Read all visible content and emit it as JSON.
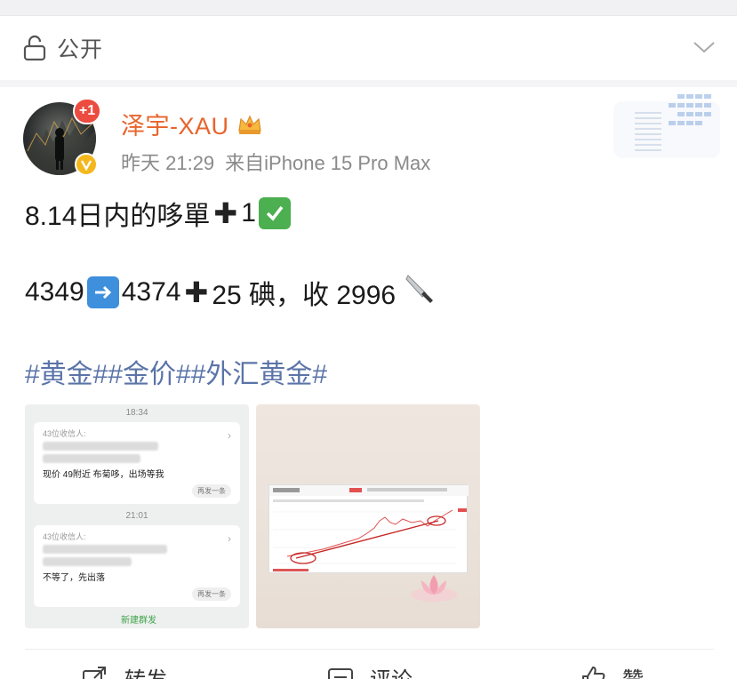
{
  "header": {
    "visibility_label": "公开"
  },
  "post": {
    "author": {
      "name": "泽宇-XAU",
      "badge_count": "+1"
    },
    "meta": {
      "time": "昨天 21:29",
      "source": "来自iPhone 15 Pro Max"
    },
    "line1": {
      "text": "8.14日内的哆單",
      "number": "1"
    },
    "line2": {
      "from": "4349",
      "to": "4374",
      "gain": "25 碘，收 2996"
    },
    "hashtags": "#黄金##金价##外汇黄金#",
    "images": {
      "chat": {
        "time1": "18:34",
        "card1_header": "43位收信人:",
        "card1_msg": "现价 49附近 布菊哆，出场等我",
        "card1_btn": "再发一条",
        "time2": "21:01",
        "card2_header": "43位收信人:",
        "card2_msg": "不等了，先出落",
        "card2_btn": "再发一条",
        "footer_link": "新建群发"
      }
    }
  },
  "actions": {
    "repost": "转发",
    "comment": "评论",
    "like": "赞"
  },
  "colors": {
    "username": "#e8642c",
    "hashtag": "#5b74a8",
    "badge": "#ec4b3f",
    "verified": "#f4b71c"
  }
}
